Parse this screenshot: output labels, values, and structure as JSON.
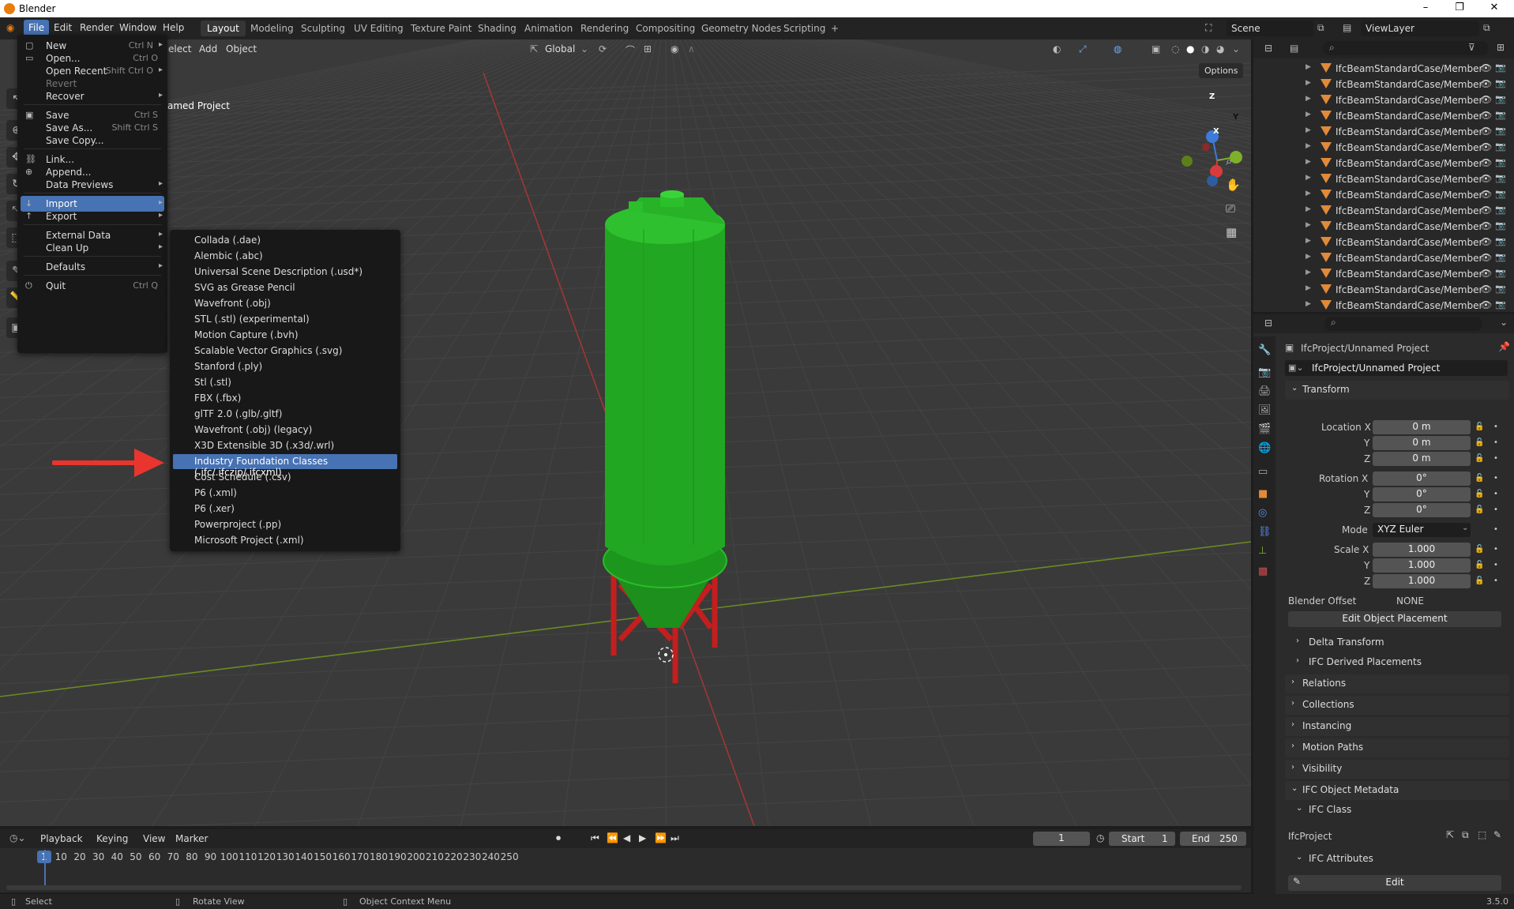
{
  "window": {
    "title": "Blender",
    "minimize": "–",
    "maximize": "❐",
    "close": "✕"
  },
  "topbar": {
    "menus": [
      "File",
      "Edit",
      "Render",
      "Window",
      "Help"
    ],
    "workspaces": [
      "Layout",
      "Modeling",
      "Sculpting",
      "UV Editing",
      "Texture Paint",
      "Shading",
      "Animation",
      "Rendering",
      "Compositing",
      "Geometry Nodes",
      "Scripting"
    ],
    "add_tab": "+",
    "scene": "Scene",
    "view_layer": "ViewLayer"
  },
  "viewport": {
    "header_menus": [
      "elect",
      "Add",
      "Object"
    ],
    "transform_orientation": "Global",
    "options_label": "Options",
    "overlay_text": "amed Project",
    "gizmo": {
      "z": "Z",
      "y": "Y",
      "x": "X"
    }
  },
  "file_menu": {
    "items": [
      {
        "icon": "▢",
        "label": "New",
        "shortcut": "Ctrl N",
        "arrow": "▸"
      },
      {
        "icon": "▭",
        "label": "Open...",
        "shortcut": "Ctrl O"
      },
      {
        "icon": "",
        "label": "Open Recent",
        "shortcut": "Shift Ctrl O",
        "arrow": "▸"
      },
      {
        "icon": "",
        "label": "Revert",
        "shortcut": ""
      },
      {
        "icon": "",
        "label": "Recover",
        "shortcut": "",
        "arrow": "▸"
      },
      {
        "icon": "▣",
        "label": "Save",
        "shortcut": "Ctrl S"
      },
      {
        "icon": "",
        "label": "Save As...",
        "shortcut": "Shift Ctrl S"
      },
      {
        "icon": "",
        "label": "Save Copy...",
        "shortcut": ""
      },
      {
        "icon": "⛓",
        "label": "Link...",
        "shortcut": ""
      },
      {
        "icon": "⊕",
        "label": "Append...",
        "shortcut": ""
      },
      {
        "icon": "",
        "label": "Data Previews",
        "shortcut": "",
        "arrow": "▸"
      },
      {
        "icon": "↓",
        "label": "Import",
        "shortcut": "",
        "arrow": "▸"
      },
      {
        "icon": "↑",
        "label": "Export",
        "shortcut": "",
        "arrow": "▸"
      },
      {
        "icon": "",
        "label": "External Data",
        "shortcut": "",
        "arrow": "▸"
      },
      {
        "icon": "",
        "label": "Clean Up",
        "shortcut": "",
        "arrow": "▸"
      },
      {
        "icon": "",
        "label": "Defaults",
        "shortcut": "",
        "arrow": "▸"
      },
      {
        "icon": "⏻",
        "label": "Quit",
        "shortcut": "Ctrl Q"
      }
    ]
  },
  "import_menu": {
    "items": [
      "Collada (.dae)",
      "Alembic (.abc)",
      "Universal Scene Description (.usd*)",
      "SVG as Grease Pencil",
      "Wavefront (.obj)",
      "STL (.stl) (experimental)",
      "Motion Capture (.bvh)",
      "Scalable Vector Graphics (.svg)",
      "Stanford (.ply)",
      "Stl (.stl)",
      "FBX (.fbx)",
      "glTF 2.0 (.glb/.gltf)",
      "Wavefront (.obj) (legacy)",
      "X3D Extensible 3D (.x3d/.wrl)",
      "Industry Foundation Classes (.ifc/.ifczip/.ifcxml)",
      "Cost Schedule (.csv)",
      "P6 (.xml)",
      "P6 (.xer)",
      "Powerproject (.pp)",
      "Microsoft Project (.xml)"
    ]
  },
  "outliner": {
    "items": [
      "IfcBeamStandardCase/Member",
      "IfcBeamStandardCase/Member",
      "IfcBeamStandardCase/Member",
      "IfcBeamStandardCase/Member",
      "IfcBeamStandardCase/Member",
      "IfcBeamStandardCase/Member",
      "IfcBeamStandardCase/Member",
      "IfcBeamStandardCase/Member",
      "IfcBeamStandardCase/Member",
      "IfcBeamStandardCase/Member",
      "IfcBeamStandardCase/Member",
      "IfcBeamStandardCase/Member",
      "IfcBeamStandardCase/Member",
      "IfcBeamStandardCase/Member",
      "IfcBeamStandardCase/Member",
      "IfcBeamStandardCase/Member"
    ]
  },
  "properties": {
    "object_path": "IfcProject/Unnamed Project",
    "object_name": "IfcProject/Unnamed Project",
    "transform_header": "Transform",
    "location": {
      "label": "Location X",
      "x": "0 m",
      "y": "0 m",
      "z": "0 m"
    },
    "rotation": {
      "label": "Rotation X",
      "x": "0°",
      "y": "0°",
      "z": "0°"
    },
    "axis_y": "Y",
    "axis_z": "Z",
    "mode_label": "Mode",
    "mode_value": "XYZ Euler",
    "scale": {
      "label": "Scale X",
      "x": "1.000",
      "y": "1.000",
      "z": "1.000"
    },
    "blender_offset_label": "Blender Offset",
    "blender_offset_value": "NONE",
    "edit_placement": "Edit Object Placement",
    "delta_transform": "Delta Transform",
    "ifc_derived": "IFC Derived Placements",
    "sections": [
      "Relations",
      "Collections",
      "Instancing",
      "Motion Paths",
      "Visibility"
    ],
    "ifc_metadata": "IFC Object Metadata",
    "ifc_class": "IFC Class",
    "ifc_class_value": "IfcProject",
    "ifc_attributes": "IFC Attributes",
    "edit_button": "Edit"
  },
  "timeline": {
    "menus": [
      "Playback",
      "Keying",
      "View",
      "Marker"
    ],
    "current_frame": "1",
    "start_label": "Start",
    "start_value": "1",
    "end_label": "End",
    "end_value": "250",
    "ticks": [
      "1",
      "10",
      "20",
      "30",
      "40",
      "50",
      "60",
      "70",
      "80",
      "90",
      "100",
      "110",
      "120",
      "130",
      "140",
      "150",
      "160",
      "170",
      "180",
      "190",
      "200",
      "210",
      "220",
      "230",
      "240",
      "250"
    ]
  },
  "statusbar": {
    "select": "Select",
    "rotate": "Rotate View",
    "context": "Object Context Menu",
    "version": "3.5.0"
  },
  "colors": {
    "accent": "#4772b3",
    "silo": "#22a722",
    "legs": "#c41e1e",
    "arrow": "#e8352e"
  }
}
